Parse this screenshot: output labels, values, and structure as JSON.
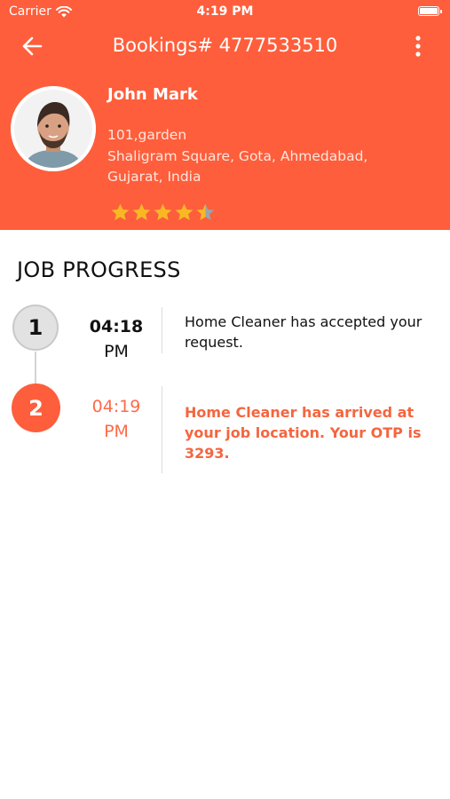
{
  "status_bar": {
    "carrier": "Carrier",
    "time": "4:19 PM"
  },
  "nav": {
    "title": "Bookings# 4777533510",
    "back_icon": "arrow-left-icon",
    "more_icon": "more-vertical-icon"
  },
  "profile": {
    "name": "John Mark",
    "address_lines": [
      "101,garden",
      "Shaligram Square, Gota, Ahmedabad,",
      "Gujarat, India"
    ],
    "rating": 4.5,
    "rating_max": 5
  },
  "job_progress": {
    "title": "JOB PROGRESS",
    "steps": [
      {
        "number": "1",
        "time": "04:18",
        "ampm": "PM",
        "text": "Home Cleaner has accepted your request."
      },
      {
        "number": "2",
        "time": "04:19",
        "ampm": "PM",
        "text": "Home Cleaner has arrived at your job location. Your OTP is 3293."
      }
    ]
  },
  "colors": {
    "brand": "#fe5e3b",
    "star": "#f9b821",
    "active_text": "#f4663f"
  }
}
